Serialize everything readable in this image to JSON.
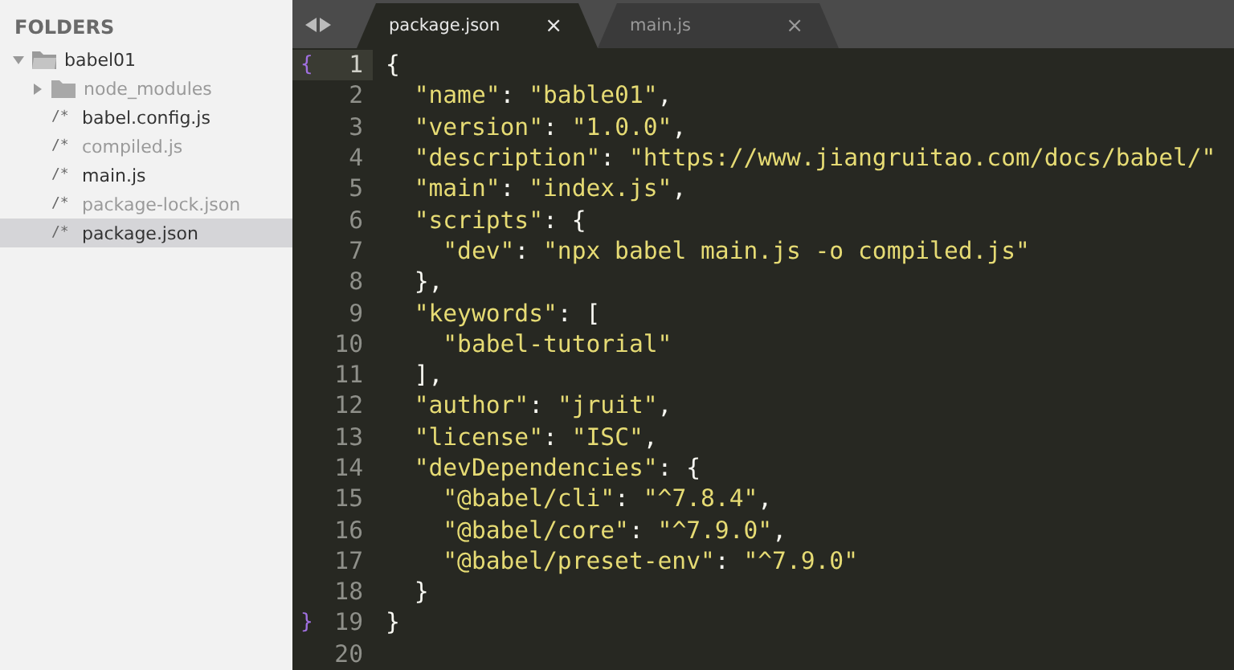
{
  "sidebar": {
    "header": "FOLDERS",
    "tree": [
      {
        "name": "babel01",
        "kind": "folder",
        "expanded": true,
        "dimmed": false,
        "selected": false,
        "children": [
          {
            "name": "node_modules",
            "kind": "folder",
            "expanded": false,
            "dimmed": true,
            "selected": false
          },
          {
            "name": "babel.config.js",
            "kind": "file",
            "glyph": "/*",
            "dimmed": false,
            "selected": false
          },
          {
            "name": "compiled.js",
            "kind": "file",
            "glyph": "/*",
            "dimmed": true,
            "selected": false
          },
          {
            "name": "main.js",
            "kind": "file",
            "glyph": "/*",
            "dimmed": false,
            "selected": false
          },
          {
            "name": "package-lock.json",
            "kind": "file",
            "glyph": "/*",
            "dimmed": true,
            "selected": false
          },
          {
            "name": "package.json",
            "kind": "file",
            "glyph": "/*",
            "dimmed": false,
            "selected": true
          }
        ]
      }
    ]
  },
  "tabs": [
    {
      "label": "package.json",
      "close": "×",
      "selected": true
    },
    {
      "label": "main.js",
      "close": "×",
      "selected": false
    }
  ],
  "editor": {
    "lines": [
      {
        "number": "1",
        "text": "{",
        "gutter_mark": "{",
        "current": true
      },
      {
        "number": "2",
        "text": "  \"name\": \"bable01\",",
        "current": false
      },
      {
        "number": "3",
        "text": "  \"version\": \"1.0.0\",",
        "current": false
      },
      {
        "number": "4",
        "text": "  \"description\": \"https://www.jiangruitao.com/docs/babel/\"",
        "current": false
      },
      {
        "number": "5",
        "text": "  \"main\": \"index.js\",",
        "current": false
      },
      {
        "number": "6",
        "text": "  \"scripts\": {",
        "current": false
      },
      {
        "number": "7",
        "text": "    \"dev\": \"npx babel main.js -o compiled.js\"",
        "current": false
      },
      {
        "number": "8",
        "text": "  },",
        "current": false
      },
      {
        "number": "9",
        "text": "  \"keywords\": [",
        "current": false
      },
      {
        "number": "10",
        "text": "    \"babel-tutorial\"",
        "current": false
      },
      {
        "number": "11",
        "text": "  ],",
        "current": false
      },
      {
        "number": "12",
        "text": "  \"author\": \"jruit\",",
        "current": false
      },
      {
        "number": "13",
        "text": "  \"license\": \"ISC\",",
        "current": false
      },
      {
        "number": "14",
        "text": "  \"devDependencies\": {",
        "current": false
      },
      {
        "number": "15",
        "text": "    \"@babel/cli\": \"^7.8.4\",",
        "current": false
      },
      {
        "number": "16",
        "text": "    \"@babel/core\": \"^7.9.0\",",
        "current": false
      },
      {
        "number": "17",
        "text": "    \"@babel/preset-env\": \"^7.9.0\"",
        "current": false
      },
      {
        "number": "18",
        "text": "  }",
        "current": false
      },
      {
        "number": "19",
        "text": "}",
        "gutter_mark": "}",
        "current": false
      },
      {
        "number": "20",
        "current": false
      }
    ]
  }
}
